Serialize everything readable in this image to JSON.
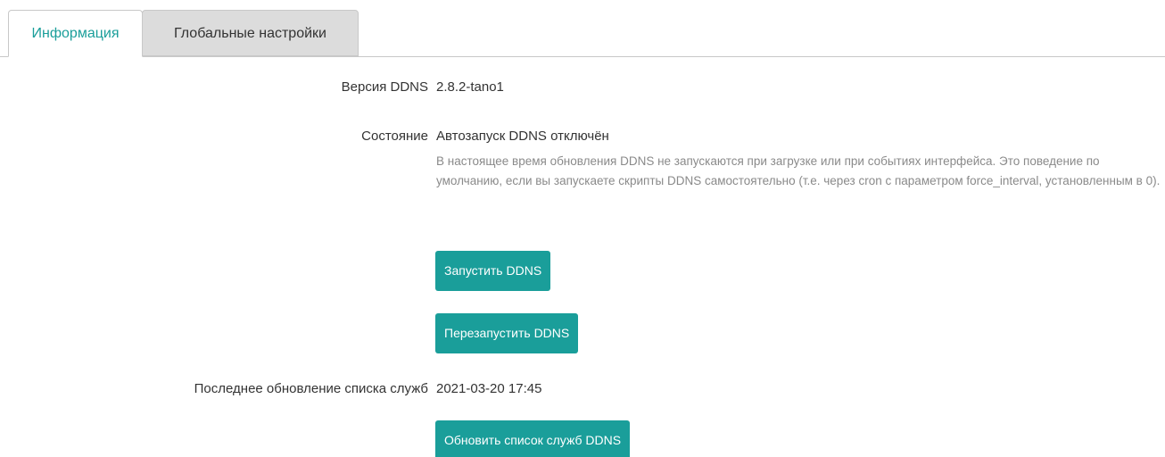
{
  "tabs": [
    {
      "label": "Информация",
      "active": true
    },
    {
      "label": "Глобальные настройки",
      "active": false
    }
  ],
  "info": {
    "version_label": "Версия DDNS",
    "version_value": "2.8.2-tano1",
    "state_label": "Состояние",
    "state_value": "Автозапуск DDNS отключён",
    "state_description": "В настоящее время обновления DDNS не запускаются при загрузке или при событиях интерфейса. Это поведение по умолчанию, если вы запускаете скрипты DDNS самостоятельно (т.е. через cron с параметром force_interval, установленным в 0).",
    "start_button": "Запустить DDNS",
    "restart_button": "Перезапустить DDNS",
    "last_update_label": "Последнее обновление списка служб",
    "last_update_value": "2021-03-20 17:45",
    "update_services_button": "Обновить список служб DDNS"
  },
  "colors": {
    "accent": "#1a9e9a",
    "tab_inactive_bg": "#dcdcdc",
    "description_text": "#8a8a8a"
  }
}
